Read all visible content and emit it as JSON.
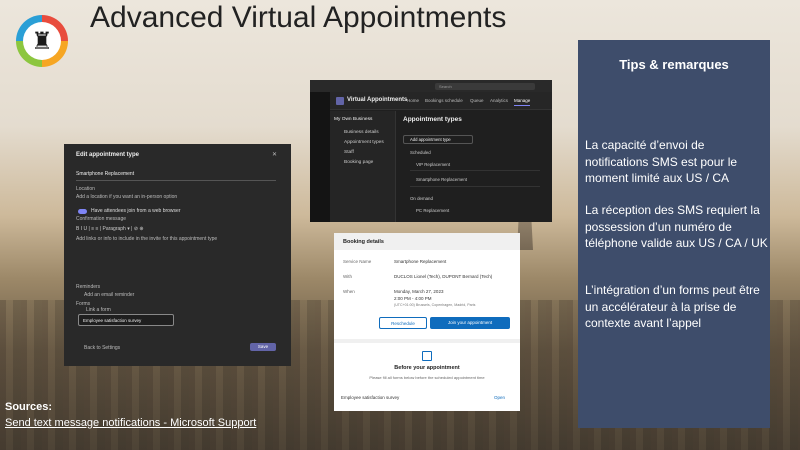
{
  "slide": {
    "title": "Advanced Virtual Appointments",
    "logo_glyph": "♜"
  },
  "tips": {
    "title": "Tips & remarques",
    "paragraphs": [
      "La capacité d’envoi de notifications SMS est pour le moment  limité aux US / CA",
      "La réception des SMS requiert la possession d’un numéro de téléphone valide aux US / CA / UK",
      "L’intégration d’un forms peut être un accélérateur à la prise de contexte avant l’appel"
    ],
    "background": "#3e4d6b"
  },
  "edit_panel": {
    "title": "Edit appointment type",
    "close_glyph": "✕",
    "name_value": "Smartphone Replacement",
    "location_label": "Location",
    "location_placeholder": "Add a location if you want an in-person option",
    "toggle_label": "Have attendees join from a web browser",
    "confirmation_label": "Confirmation message",
    "toolbar_text": "B  I  U  |  ≡  ≡  |  Paragraph  ▾  |  ⊘  ⊕",
    "confirmation_placeholder": "Add links or info to include in the invite for this appointment type",
    "reminders_label": "Reminders",
    "add_reminder": "Add an email reminder",
    "forms_label": "Forms",
    "link_form": "Link a form",
    "survey_name": "Employee satisfaction survey",
    "back_label": "Back to Settings",
    "save_label": "Save"
  },
  "teams_panel": {
    "search_placeholder": "Search",
    "app_title": "Virtual Appointments",
    "nav": [
      "Home",
      "Bookings schedule",
      "Queue",
      "Analytics",
      "Manage"
    ],
    "active_nav": "Manage",
    "business": "My Own Business",
    "sidebar": [
      "Business details",
      "Appointment types",
      "Staff",
      "Booking page"
    ],
    "heading": "Appointment types",
    "add_button": "Add appointment type",
    "scheduled_label": "Scheduled",
    "scheduled_items": [
      "VIP Replacement",
      "Smartphone Replacement"
    ],
    "on_demand_label": "On demand",
    "on_demand_items": [
      "PC Replacement"
    ]
  },
  "booking_panel": {
    "title": "Booking details",
    "rows": [
      {
        "label": "Service Name",
        "value": "Smartphone Replacement"
      },
      {
        "label": "With",
        "value": "DUCLOS Lionel (Tech), DUPONT Bernard (Tech)"
      },
      {
        "label": "When",
        "value": "Monday, March 27, 2023"
      }
    ],
    "time": "2:00 PM - 4:00 PM",
    "timezone": "(UTC+01:00) Brussels, Copenhagen, Madrid, Paris",
    "reschedule_label": "Reschedule",
    "join_label": "Join your appointment",
    "before_title": "Before your appointment",
    "before_sub": "Please fill all forms below before the scheduled appointment time",
    "survey_name": "Employee satisfaction survey",
    "open_label": "Open"
  },
  "sources": {
    "label": "Sources:",
    "link_text": "Send text message notifications - Microsoft Support"
  }
}
